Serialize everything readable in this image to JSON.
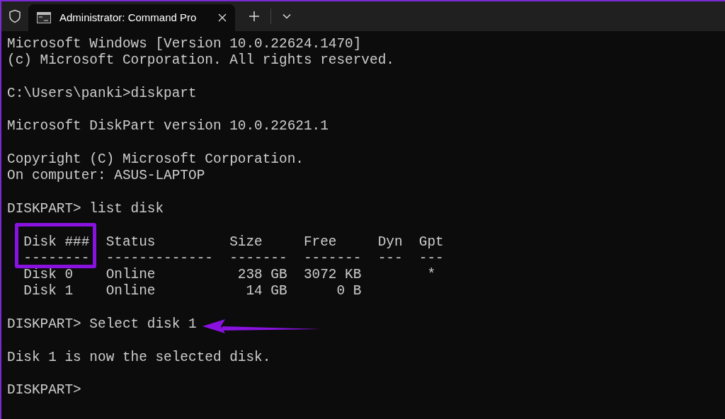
{
  "window": {
    "tab_title": "Administrator: Command Pro"
  },
  "terminal": {
    "blocks": [
      [
        "Microsoft Windows [Version 10.0.22624.1470]",
        "(c) Microsoft Corporation. All rights reserved."
      ],
      [
        "C:\\Users\\panki>diskpart"
      ],
      [
        "Microsoft DiskPart version 10.0.22621.1"
      ],
      [
        "Copyright (C) Microsoft Corporation.",
        "On computer: ASUS-LAPTOP"
      ],
      [
        "DISKPART> list disk"
      ],
      [
        "  Disk ###  Status         Size     Free     Dyn  Gpt",
        "  --------  -------------  -------  -------  ---  ---",
        "  Disk 0    Online          238 GB  3072 KB        *",
        "  Disk 1    Online           14 GB      0 B"
      ],
      [
        "DISKPART> Select disk 1"
      ],
      [
        "Disk 1 is now the selected disk."
      ],
      [
        "DISKPART>"
      ]
    ]
  }
}
